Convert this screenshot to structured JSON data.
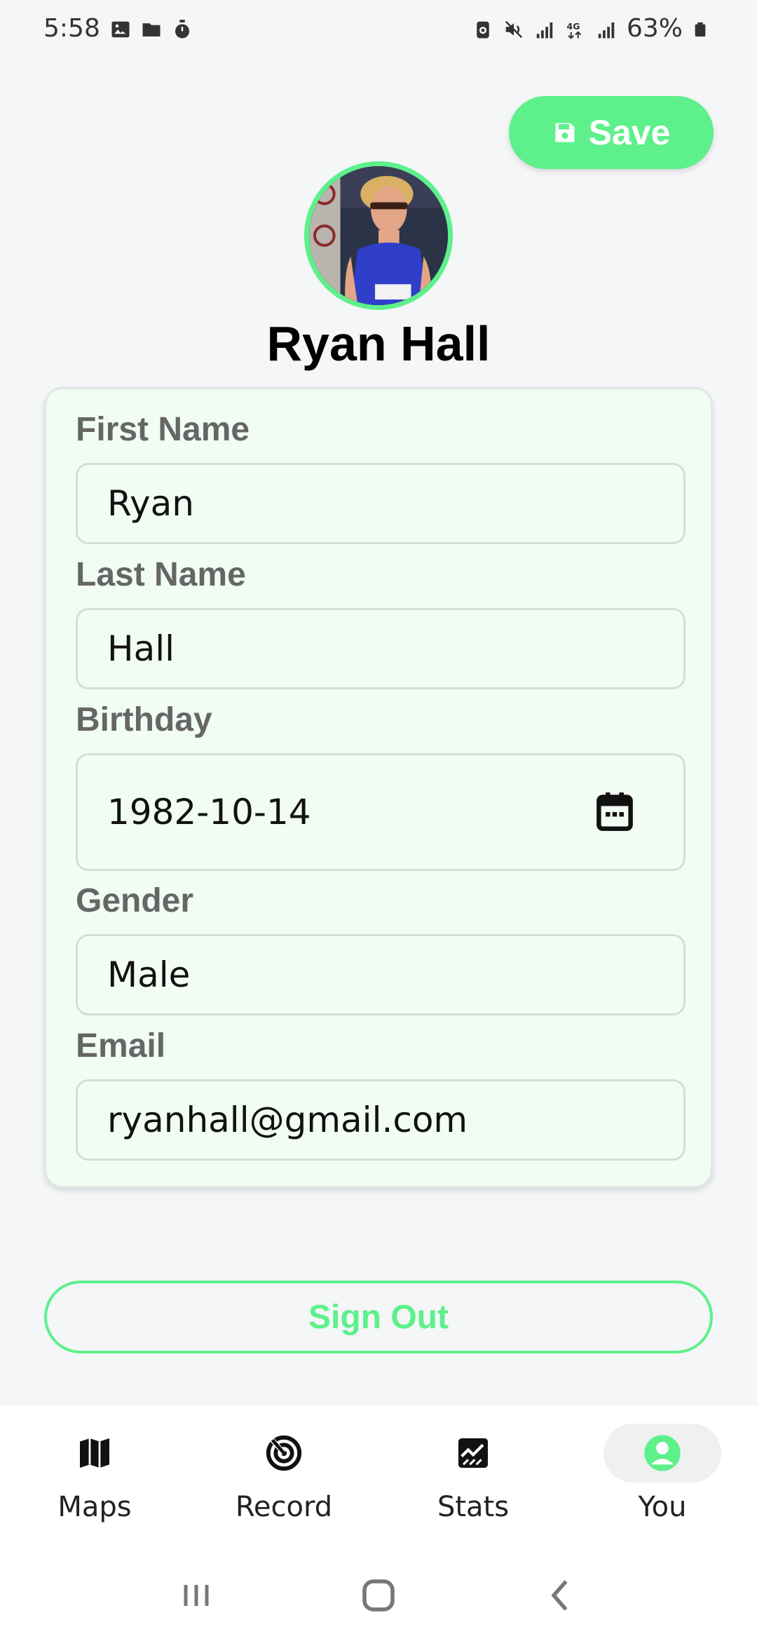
{
  "status_bar": {
    "time": "5:58",
    "battery": "63%"
  },
  "header": {
    "save_label": "Save"
  },
  "profile": {
    "name": "Ryan Hall"
  },
  "form": {
    "first_name": {
      "label": "First Name",
      "value": "Ryan"
    },
    "last_name": {
      "label": "Last Name",
      "value": "Hall"
    },
    "birthday": {
      "label": "Birthday",
      "value": "1982-10-14"
    },
    "gender": {
      "label": "Gender",
      "value": "Male"
    },
    "email": {
      "label": "Email",
      "value": "ryanhall@gmail.com"
    }
  },
  "signout_label": "Sign Out",
  "bottom_nav": {
    "items": [
      {
        "label": "Maps",
        "icon": "map-icon",
        "active": false
      },
      {
        "label": "Record",
        "icon": "record-icon",
        "active": false
      },
      {
        "label": "Stats",
        "icon": "stats-icon",
        "active": false
      },
      {
        "label": "You",
        "icon": "person-icon",
        "active": true
      }
    ]
  },
  "colors": {
    "accent": "#5ef08a",
    "card_bg": "#f1fdf3",
    "page_bg": "#f4f6f8"
  }
}
